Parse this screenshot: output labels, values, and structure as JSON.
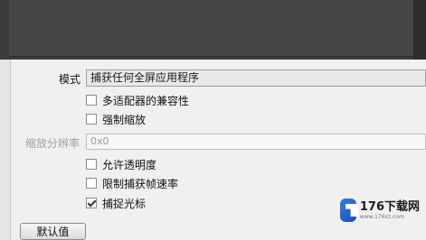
{
  "form": {
    "mode_label": "模式",
    "mode_value": "捕获任何全屏应用程序",
    "multi_adapter_label": "多适配器的兼容性",
    "multi_adapter_checked": false,
    "force_scale_label": "强制缩放",
    "force_scale_checked": false,
    "scale_resolution_label": "缩放分辨率",
    "scale_resolution_value": "0x0",
    "allow_transparency_label": "允许透明度",
    "allow_transparency_checked": false,
    "limit_framerate_label": "限制捕获帧速率",
    "limit_framerate_checked": false,
    "capture_cursor_label": "捕捉光标",
    "capture_cursor_checked": true
  },
  "buttons": {
    "defaults_label": "默认值"
  },
  "watermark": {
    "main": "176下载网",
    "sub": "www.176xz.com"
  },
  "colors": {
    "preview_bg": "#454545",
    "dialog_bg": "#f0f0f0",
    "watermark_blue": "#2a63c8"
  }
}
